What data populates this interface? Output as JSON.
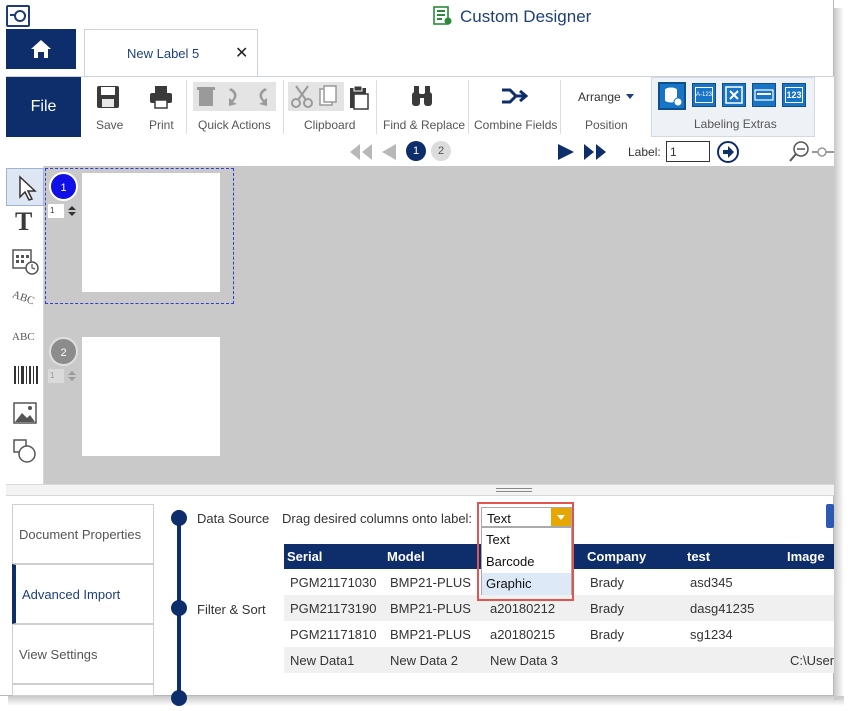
{
  "window": {
    "title": "Custom Designer"
  },
  "tabs": {
    "document_tab": "New Label 5",
    "close_glyph": "✕"
  },
  "ribbon": {
    "file": "File",
    "save": "Save",
    "print": "Print",
    "quick_actions": "Quick Actions",
    "clipboard": "Clipboard",
    "find_replace": "Find & Replace",
    "combine_fields": "Combine Fields",
    "arrange": "Arrange",
    "position": "Position",
    "labeling_extras": "Labeling Extras",
    "extras_icons": [
      "A-123",
      "123"
    ]
  },
  "nav": {
    "pages": [
      "1",
      "2"
    ],
    "label_caption": "Label:",
    "label_value": "1"
  },
  "canvas": {
    "labels": [
      {
        "number": "1",
        "copies": "1"
      },
      {
        "number": "2",
        "copies": "1"
      }
    ]
  },
  "toolbox": {
    "text_tool_glyph": "T",
    "abc_glyph": "ABC"
  },
  "panel": {
    "side_tabs": [
      "Document Properties",
      "Advanced Import",
      "View Settings"
    ],
    "sections": [
      "Data Source",
      "Filter & Sort"
    ],
    "drag_hint": "Drag desired columns onto label:",
    "dropdown": {
      "selected": "Text",
      "options": [
        "Text",
        "Barcode",
        "Graphic"
      ]
    },
    "table": {
      "headers": [
        "Serial",
        "Model",
        "",
        "Company",
        "test",
        "Image"
      ],
      "rows": [
        [
          "PGM21171030",
          "BMP21-PLUS",
          "",
          "Brady",
          "asd345",
          ""
        ],
        [
          "PGM21173190",
          "BMP21-PLUS",
          "a20180212",
          "Brady",
          "dasg41235",
          ""
        ],
        [
          "PGM21171810",
          "BMP21-PLUS",
          "a20180215",
          "Brady",
          "sg1234",
          ""
        ],
        [
          "New Data1",
          "New Data 2",
          "New Data 3",
          "",
          "",
          "C:\\User"
        ]
      ]
    }
  },
  "colors": {
    "navy": "#0e2d6b",
    "accent_blue": "#1875c6",
    "dropdown_arrow": "#e6a700",
    "highlight": "#e0554f"
  }
}
